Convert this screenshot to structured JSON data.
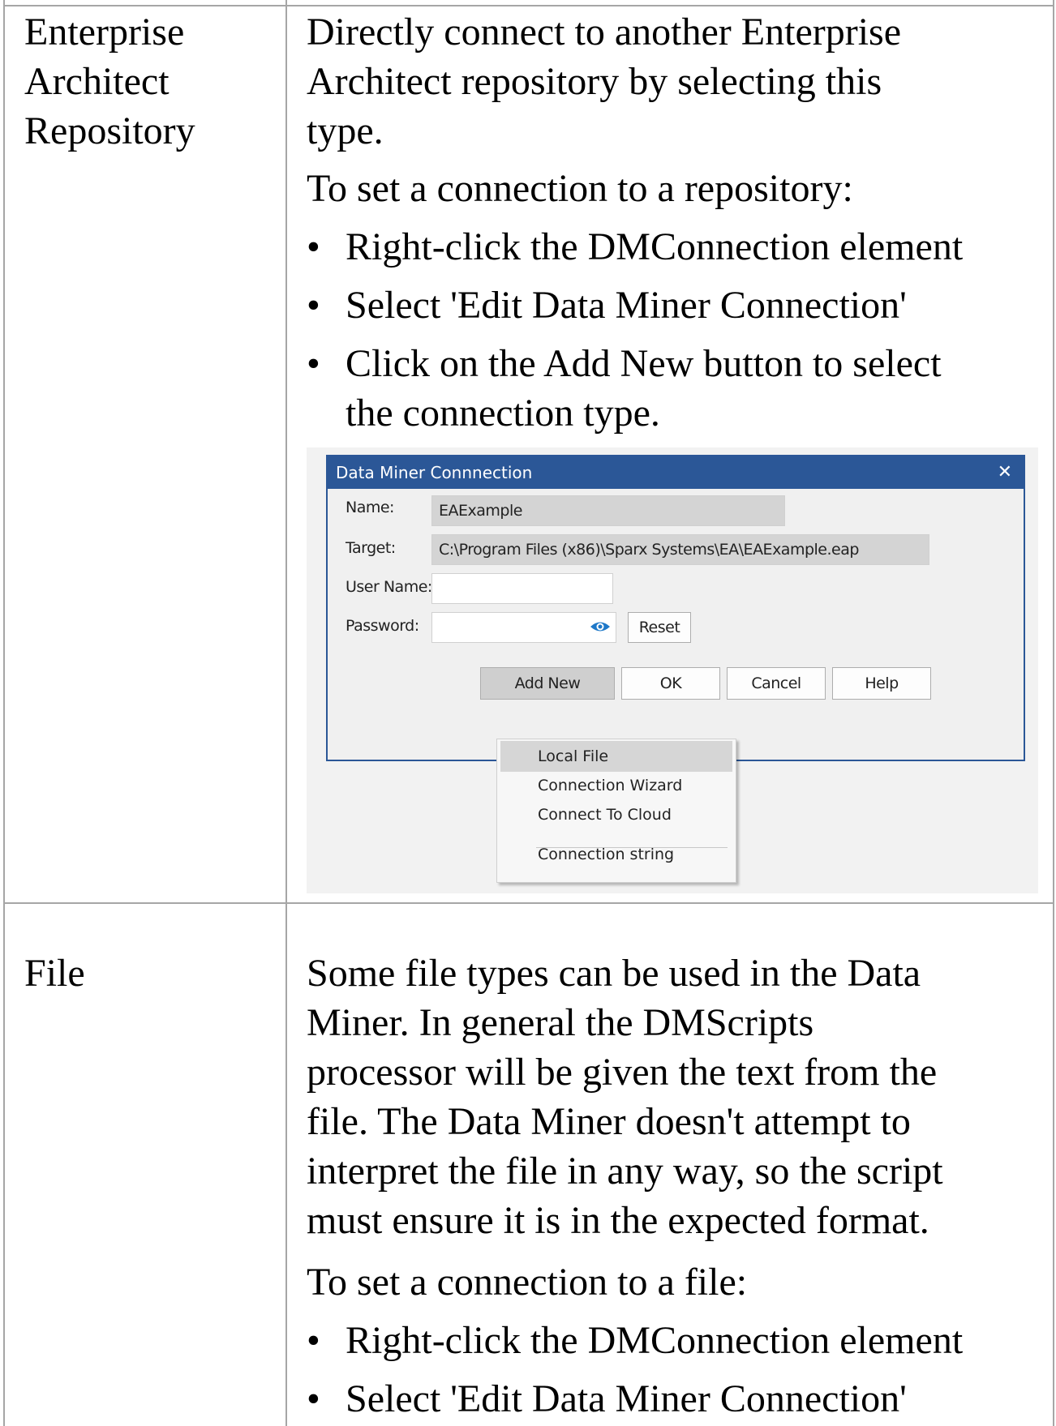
{
  "rows": [
    {
      "term_lines": [
        "Enterprise",
        "Architect",
        "Repository"
      ],
      "description_lines": [
        "Directly connect to another Enterprise",
        "Architect repository by selecting this",
        "type."
      ],
      "instruction": "To set a connection to a repository:",
      "bullets": [
        "Right-click the DMConnection element",
        "Select 'Edit Data Miner Connection'",
        "Click on the Add New button to select",
        "the connection type."
      ]
    },
    {
      "term": "File",
      "description_lines": [
        "Some file types can be used in the Data",
        "Miner. In general the DMScripts",
        "processor will be given the text from the",
        "file. The Data Miner doesn't attempt to",
        "interpret the file in any way, so the script",
        "must ensure it is in the expected format."
      ],
      "instruction": "To set a connection to a file:",
      "bullets": [
        "Right-click the DMConnection element",
        "Select 'Edit Data Miner Connection'"
      ]
    }
  ],
  "bullet_glyph": "•",
  "dialog": {
    "title": "Data Miner Connnection",
    "close_glyph": "✕",
    "name_label": "Name:",
    "name_value": "EAExample",
    "target_label": "Target:",
    "target_value": "C:\\Program Files (x86)\\Sparx Systems\\EA\\EAExample.eap",
    "username_label": "User Name:",
    "username_value": "",
    "password_label": "Password:",
    "password_value": "",
    "password_icon": "eye-icon",
    "reset_label": "Reset",
    "buttons": [
      "Add New",
      "OK",
      "Cancel",
      "Help"
    ],
    "menu_items": [
      "Local File",
      "Connection Wizard",
      "Connect To Cloud",
      "Connection string"
    ],
    "highlighted_menu_item": "Local File",
    "accent_color": "#2b5797"
  }
}
